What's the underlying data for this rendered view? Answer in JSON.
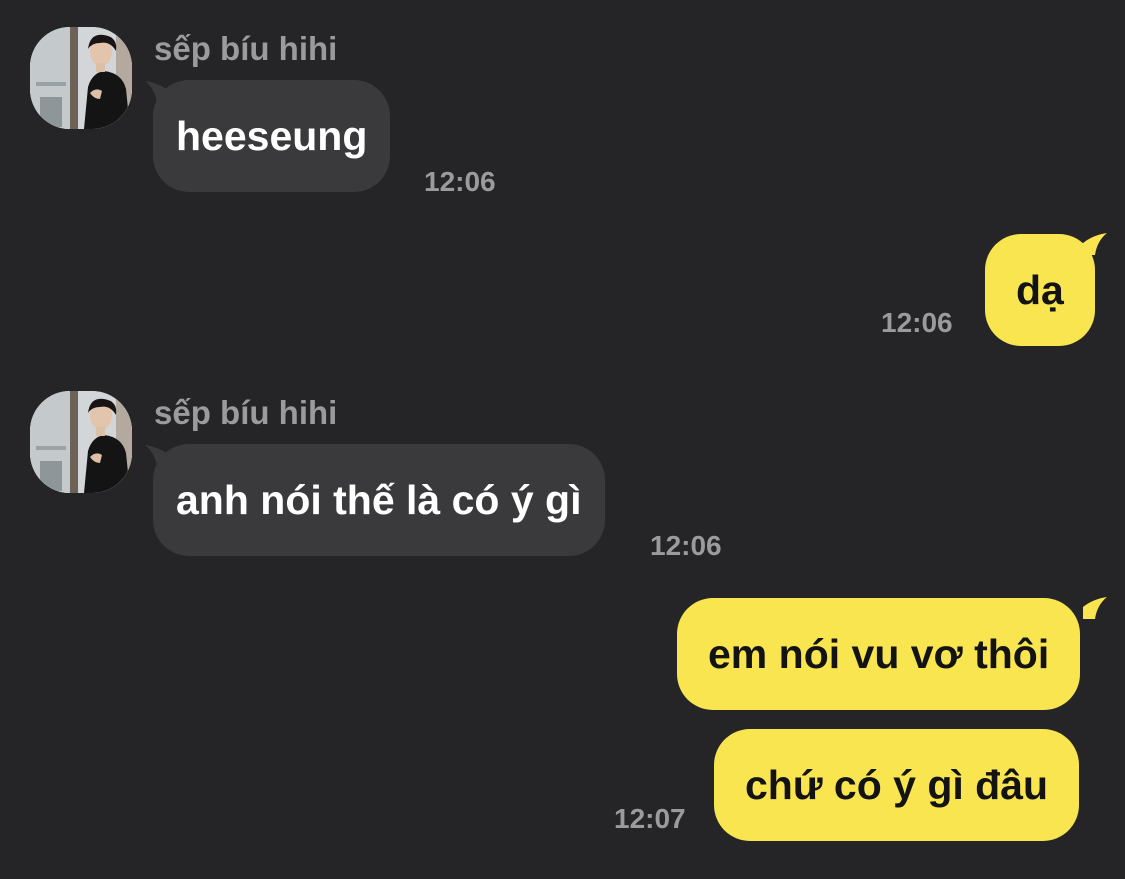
{
  "messages": [
    {
      "from": "sếp bíu hihi",
      "text": "heeseung",
      "time": "12:06"
    },
    {
      "from": "me",
      "text": "dạ",
      "time": "12:06"
    },
    {
      "from": "sếp bíu hihi",
      "text": "anh nói thế là có ý gì",
      "time": "12:06"
    },
    {
      "from": "me",
      "text": "em nói vu vơ thôi"
    },
    {
      "from": "me",
      "text": "chứ có ý gì đâu",
      "time": "12:07"
    }
  ],
  "colors": {
    "background": "#252527",
    "incoming_bubble": "#3a3a3c",
    "outgoing_bubble": "#f9e54f",
    "meta_text": "#9b9b9e"
  }
}
